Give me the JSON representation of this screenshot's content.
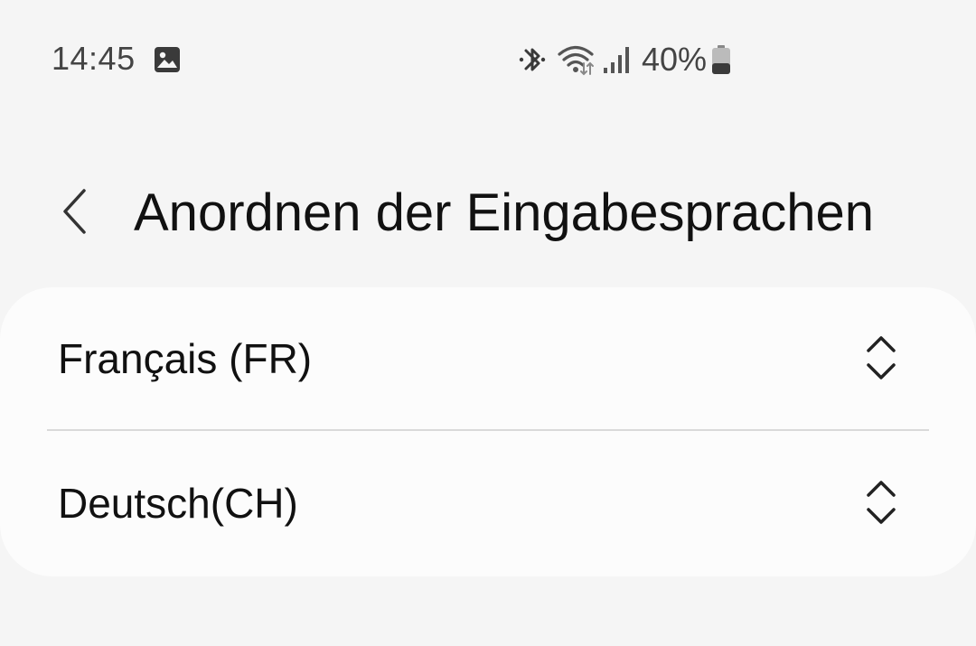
{
  "status_bar": {
    "time": "14:45",
    "battery_percent": "40%",
    "battery_level": 0.4,
    "icons": [
      "gallery-icon",
      "bluetooth-icon",
      "wifi-icon",
      "signal-icon",
      "battery-icon"
    ]
  },
  "header": {
    "title": "Anordnen der Eingabesprachen",
    "back_icon": "chevron-left-icon"
  },
  "languages": [
    {
      "label": "Français (FR)",
      "handle_icon": "reorder-arrows-icon"
    },
    {
      "label": "Deutsch(CH)",
      "handle_icon": "reorder-arrows-icon"
    }
  ],
  "colors": {
    "background": "#f5f5f5",
    "card": "#fcfcfc",
    "divider": "#d9d9d9",
    "text": "#111111",
    "status_text": "#444444"
  }
}
